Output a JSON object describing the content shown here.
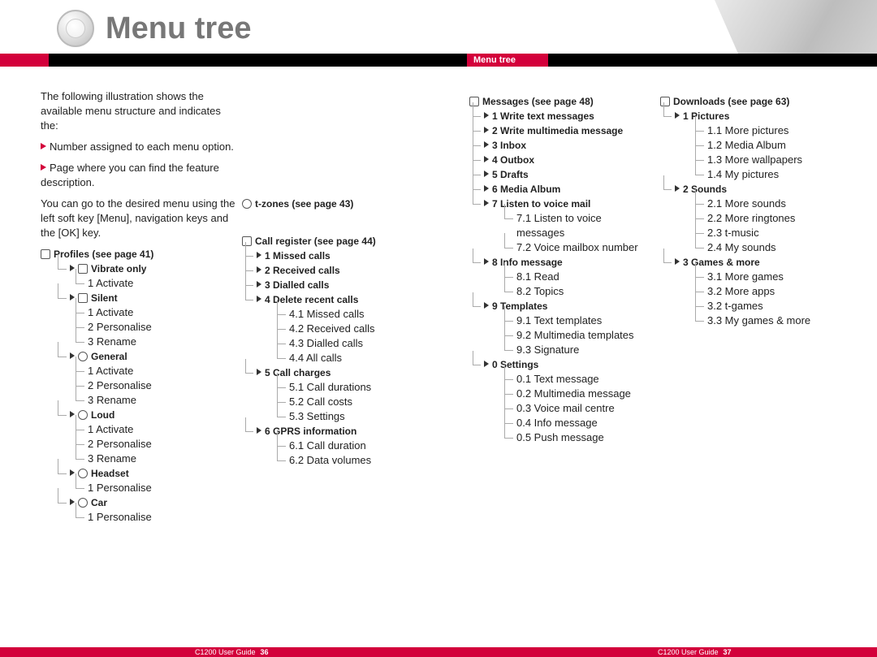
{
  "header": {
    "title": "Menu tree",
    "tab_label": "Menu tree"
  },
  "intro": {
    "p1": "The following illustration shows the available menu structure and indicates the:",
    "b1": "Number assigned to each menu option.",
    "b2": "Page where you can find the feature description.",
    "p2": "You can go to the desired menu using the left soft key [Menu], navigation keys and the [OK] key."
  },
  "profiles": {
    "head": "Profiles (see page 41)",
    "vibrate": "Vibrate only",
    "vibrate_1": "1 Activate",
    "silent": "Silent",
    "silent_1": "1 Activate",
    "silent_2": "2 Personalise",
    "silent_3": "3 Rename",
    "general": "General",
    "general_1": "1 Activate",
    "general_2": "2 Personalise",
    "general_3": "3 Rename",
    "loud": "Loud",
    "loud_1": "1 Activate",
    "loud_2": "2 Personalise",
    "loud_3": "3 Rename",
    "headset": "Headset",
    "headset_1": "1 Personalise",
    "car": "Car",
    "car_1": "1 Personalise"
  },
  "tzones": {
    "head": "t-zones (see page 43)"
  },
  "callreg": {
    "head": "Call register (see page 44)",
    "m1": "1 Missed calls",
    "m2": "2 Received calls",
    "m3": "3 Dialled calls",
    "m4": "4 Delete recent calls",
    "m4_1": "4.1 Missed calls",
    "m4_2": "4.2 Received calls",
    "m4_3": "4.3 Dialled calls",
    "m4_4": "4.4 All calls",
    "m5": "5 Call charges",
    "m5_1": "5.1 Call durations",
    "m5_2": "5.2 Call costs",
    "m5_3": "5.3 Settings",
    "m6": "6 GPRS information",
    "m6_1": "6.1 Call duration",
    "m6_2": "6.2 Data volumes"
  },
  "messages": {
    "head": "Messages (see page 48)",
    "m1": "1 Write text messages",
    "m2": "2 Write multimedia message",
    "m3": "3 Inbox",
    "m4": "4 Outbox",
    "m5": "5 Drafts",
    "m6": "6 Media Album",
    "m7": "7 Listen to voice mail",
    "m7_1": "7.1 Listen to voice messages",
    "m7_2": "7.2 Voice mailbox number",
    "m8": "8 Info message",
    "m8_1": "8.1 Read",
    "m8_2": "8.2 Topics",
    "m9": "9 Templates",
    "m9_1": "9.1 Text templates",
    "m9_2": "9.2 Multimedia templates",
    "m9_3": "9.3 Signature",
    "m0": "0 Settings",
    "m0_1": "0.1 Text message",
    "m0_2": "0.2 Multimedia message",
    "m0_3": "0.3 Voice mail centre",
    "m0_4": "0.4 Info message",
    "m0_5": "0.5 Push message"
  },
  "downloads": {
    "head": "Downloads (see page 63)",
    "m1": "1 Pictures",
    "m1_1": "1.1 More pictures",
    "m1_2": "1.2 Media Album",
    "m1_3": "1.3 More wallpapers",
    "m1_4": "1.4 My pictures",
    "m2": "2 Sounds",
    "m2_1": "2.1 More sounds",
    "m2_2": "2.2 More ringtones",
    "m2_3": "2.3 t-music",
    "m2_4": "2.4 My sounds",
    "m3": "3 Games & more",
    "m3_1": "3.1 More games",
    "m3_2": "3.2 More apps",
    "m3_3": "3.2 t-games",
    "m3_4": "3.3 My games & more"
  },
  "footer": {
    "guide": "C1200 User Guide",
    "left_page": "36",
    "right_page": "37"
  }
}
